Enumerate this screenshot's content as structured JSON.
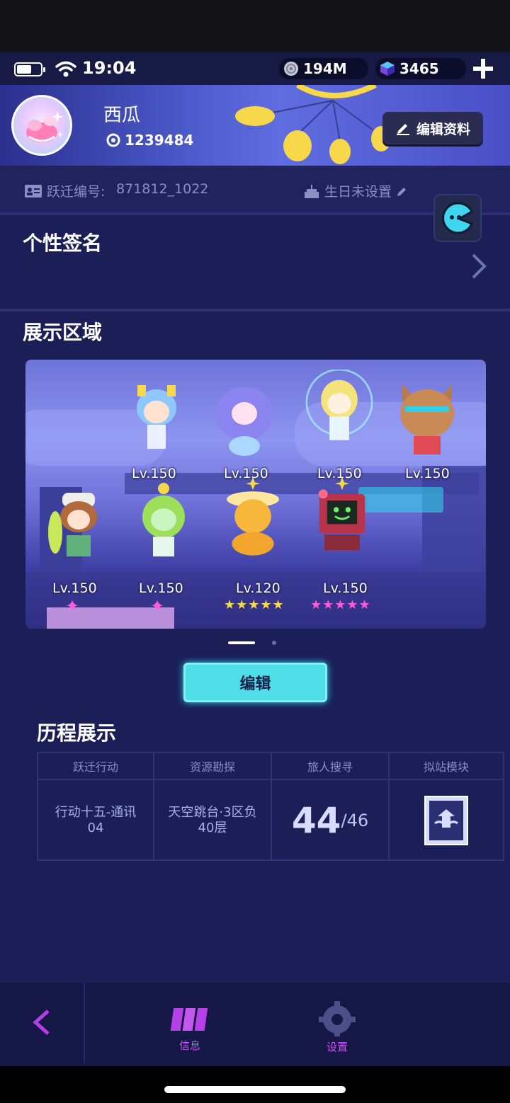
{
  "status_bar": {
    "time": "19:04",
    "currency_1": {
      "icon": "coin-icon",
      "value": "194M"
    },
    "currency_2": {
      "icon": "crystal-icon",
      "value": "3465"
    }
  },
  "profile": {
    "name": "西瓜",
    "uid": "1239484",
    "edit_label": "编辑资料"
  },
  "id_row": {
    "id_label": "跃迁编号:",
    "id_value": "871812_1022",
    "birthday_label": "生日未设置"
  },
  "signature": {
    "title": "个性签名"
  },
  "showcase": {
    "title": "展示区域",
    "top_row": [
      {
        "level": "Lv.150"
      },
      {
        "level": "Lv.150"
      },
      {
        "level": "Lv.150"
      },
      {
        "level": "Lv.150"
      }
    ],
    "bottom_row": [
      {
        "level": "Lv.150"
      },
      {
        "level": "Lv.150"
      },
      {
        "level": "Lv.120",
        "stars": "★★★★★"
      },
      {
        "level": "Lv.150",
        "stars": "★★★★★"
      }
    ],
    "edit_label": "编辑"
  },
  "history": {
    "title": "历程展示",
    "columns": [
      {
        "header": "跃迁行动",
        "value": "行动十五-通讯04"
      },
      {
        "header": "资源勘探",
        "value": "天空跳台·3区负40层"
      },
      {
        "header": "旅人搜寻",
        "value_big": "44",
        "value_small": "/46"
      },
      {
        "header": "拟站模块"
      }
    ]
  },
  "bottom_nav": {
    "info_label": "信息",
    "settings_label": "设置"
  },
  "colors": {
    "background": "#1b1e57",
    "accent_cyan": "#4fdde8",
    "nav_purple": "#b640e8"
  }
}
